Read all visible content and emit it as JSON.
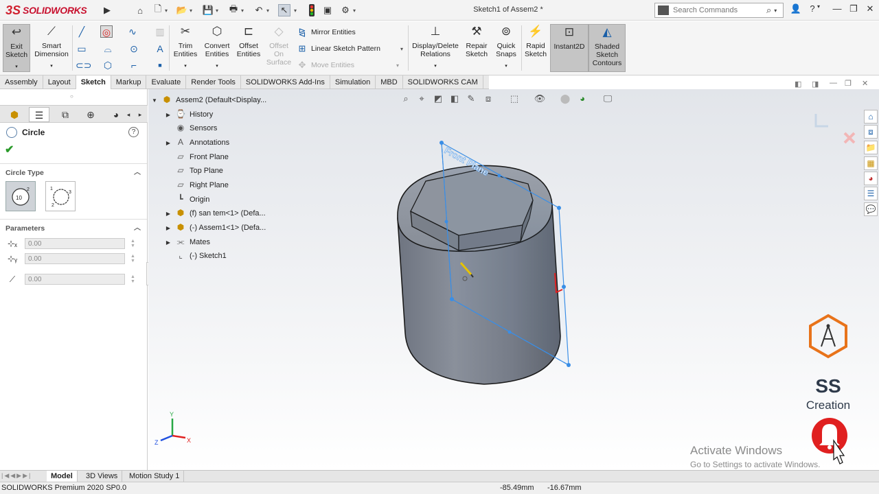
{
  "app": {
    "logo_ds": "3S",
    "logo_name": "SOLIDWORKS",
    "doc_title": "Sketch1 of Assem2 *",
    "search_placeholder": "Search Commands"
  },
  "ribbon": {
    "exit_sketch": [
      "Exit",
      "Sketch"
    ],
    "smart_dimension": [
      "Smart",
      "Dimension"
    ],
    "trim_entities": [
      "Trim",
      "Entities"
    ],
    "convert_entities": [
      "Convert",
      "Entities"
    ],
    "offset_entities": [
      "Offset",
      "Entities"
    ],
    "offset_on_surface": [
      "Offset",
      "On",
      "Surface"
    ],
    "mirror_entities": "Mirror Entities",
    "linear_sketch_pattern": "Linear Sketch Pattern",
    "move_entities": "Move Entities",
    "display_delete_relations": [
      "Display/Delete",
      "Relations"
    ],
    "repair_sketch": [
      "Repair",
      "Sketch"
    ],
    "quick_snaps": [
      "Quick",
      "Snaps"
    ],
    "rapid_sketch": [
      "Rapid",
      "Sketch"
    ],
    "instant2d": "Instant2D",
    "shaded_sketch_contours": [
      "Shaded",
      "Sketch",
      "Contours"
    ]
  },
  "tabs": [
    "Assembly",
    "Layout",
    "Sketch",
    "Markup",
    "Evaluate",
    "Render Tools",
    "SOLIDWORKS Add-Ins",
    "Simulation",
    "MBD",
    "SOLIDWORKS CAM"
  ],
  "property_manager": {
    "title": "Circle",
    "help": "?",
    "circle_type_heading": "Circle Type",
    "parameters_heading": "Parameters",
    "x_value": "0.00",
    "y_value": "0.00",
    "radius_value": "0.00"
  },
  "tree": {
    "root": "Assem2  (Default<Display...",
    "items": [
      "History",
      "Sensors",
      "Annotations",
      "Front Plane",
      "Top Plane",
      "Right Plane",
      "Origin",
      "(f) san tem<1> (Defa...",
      "(-) Assem1<1> (Defa...",
      "Mates",
      "(-) Sketch1"
    ]
  },
  "viewport": {
    "plane_label": "Front Plane",
    "triad_y": "Y",
    "triad_x": "X",
    "triad_z": "Z"
  },
  "watermark": {
    "line1": "SS",
    "line2": "Creation"
  },
  "activate": {
    "line1": "Activate Windows",
    "line2": "Go to Settings to activate Windows."
  },
  "bottom_tabs": [
    "Model",
    "3D Views",
    "Motion Study 1"
  ],
  "status": {
    "product": "SOLIDWORKS Premium 2020 SP0.0",
    "x_coord": "-85.49mm",
    "y_coord": "-16.67mm"
  },
  "colors": {
    "brand_red": "#c8102e",
    "sketch_blue": "#3a8ee6",
    "body_gray": "#7c8390",
    "watermark_orange": "#e8731a",
    "bell_red": "#e02020"
  }
}
